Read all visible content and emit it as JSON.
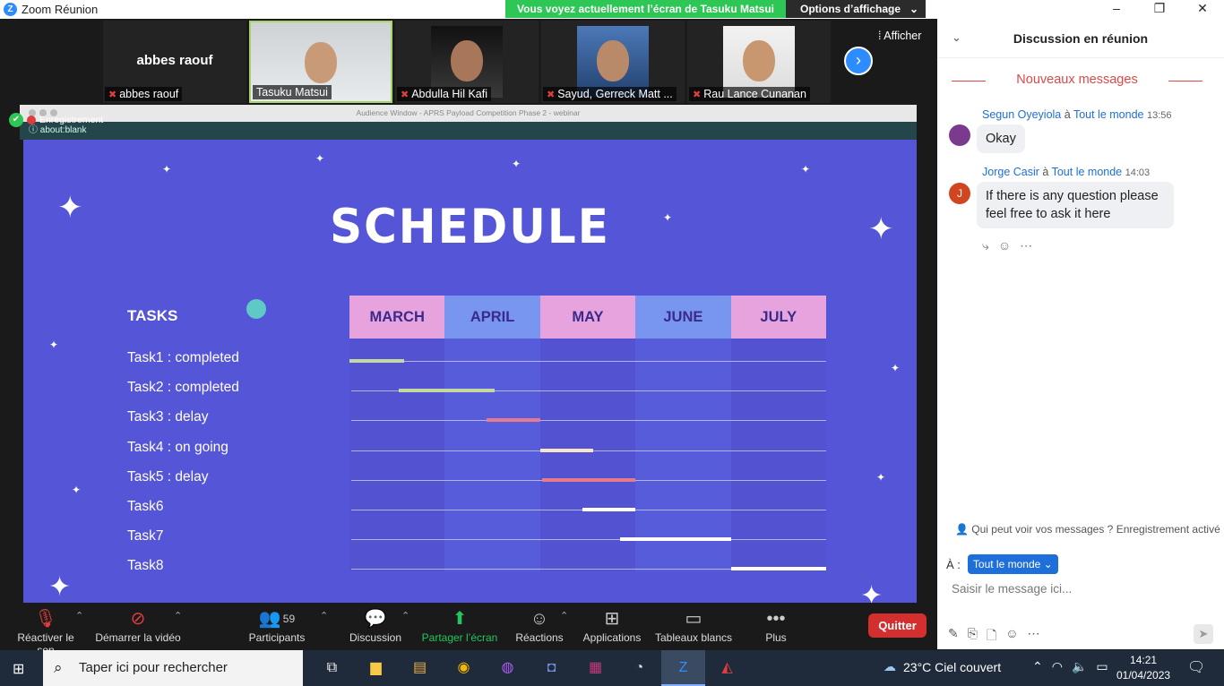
{
  "window": {
    "title": "Zoom Réunion",
    "controls": [
      "–",
      "❐",
      "✕"
    ]
  },
  "share_banner": {
    "message": "Vous voyez actuellement l’écran de Tasuku Matsui",
    "options": "Options d’affichage",
    "chevron": "⌄"
  },
  "participants": [
    {
      "name": "abbes raouf",
      "big_name": "abbes raouf",
      "muted": true,
      "video": false
    },
    {
      "name": "Tasuku Matsui",
      "muted": false,
      "video": true,
      "active": true
    },
    {
      "name": "Abdulla Hil Kafi",
      "muted": true,
      "video": true
    },
    {
      "name": "Sayud, Gerreck Matt ...",
      "muted": true,
      "video": true
    },
    {
      "name": "Rau Lance Cunanan",
      "muted": true,
      "video": true
    }
  ],
  "next_arrow": "›",
  "show_label": "Afficher",
  "shared_window": {
    "title": "Audience Window - APRS Payload Competition Phase 2 - webinar",
    "url": "about:blank",
    "recording": "Enregistrement"
  },
  "slide": {
    "title": "SCHEDULE",
    "tasks_header": "TASKS",
    "tasks": [
      "Task1 : completed",
      "Task2 : completed",
      "Task3  : delay",
      "Task4 : on going",
      "Task5 : delay",
      "Task6",
      "Task7",
      "Task8"
    ],
    "months": [
      "MARCH",
      "APRIL",
      "MAY",
      "JUNE",
      "JULY"
    ],
    "bars": [
      {
        "start": 0.0,
        "end": 0.57,
        "color": "#c5d8a0"
      },
      {
        "start": 0.52,
        "end": 1.52,
        "color": "#c5d8a0"
      },
      {
        "start": 1.44,
        "end": 2.0,
        "color": "#e57a8c"
      },
      {
        "start": 2.0,
        "end": 2.56,
        "color": "#f5e6c8"
      },
      {
        "start": 2.02,
        "end": 3.0,
        "color": "#e57a8c"
      },
      {
        "start": 2.44,
        "end": 3.0,
        "color": "#ffffff"
      },
      {
        "start": 2.84,
        "end": 4.0,
        "color": "#ffffff"
      },
      {
        "start": 4.0,
        "end": 5.0,
        "color": "#ffffff"
      }
    ]
  },
  "chat": {
    "title": "Discussion en réunion",
    "new_messages": "Nouveaux messages",
    "messages": [
      {
        "sender": "Segun Oyeyiola",
        "to_word": "à",
        "recipient": "Tout le monde",
        "time": "13:56",
        "text": "Okay",
        "avatar": "",
        "avatar_color": "#7a3b8f"
      },
      {
        "sender": "Jorge Casir",
        "to_word": "à",
        "recipient": "Tout le monde",
        "time": "14:03",
        "text": "If there is any question please feel free to ask it here",
        "avatar": "J",
        "avatar_color": "#d1451f"
      }
    ],
    "visibility_note": "Qui peut voir vos messages ? Enregistrement activé",
    "to_label": "À :",
    "to_value": "Tout le monde",
    "input_placeholder": "Saisir le message ici..."
  },
  "toolbar": {
    "unmute": "Réactiver le son",
    "start_video": "Démarrer la vidéo",
    "participants": "Participants",
    "participants_count": "59",
    "chat": "Discussion",
    "share": "Partager l’écran",
    "reactions": "Réactions",
    "apps": "Applications",
    "whiteboards": "Tableaux blancs",
    "more": "Plus",
    "quit": "Quitter"
  },
  "taskbar": {
    "search_placeholder": "Taper ici pour rechercher",
    "weather": "23°C  Ciel couvert",
    "time": "14:21",
    "date": "01/04/2023"
  },
  "colors": {
    "accent": "#2d8cff",
    "share_green": "#2ec655",
    "slide_bg": "#5555d8",
    "quit_red": "#d32f2f",
    "month_pink": "#e6a3de",
    "month_blue": "#7895f0"
  }
}
